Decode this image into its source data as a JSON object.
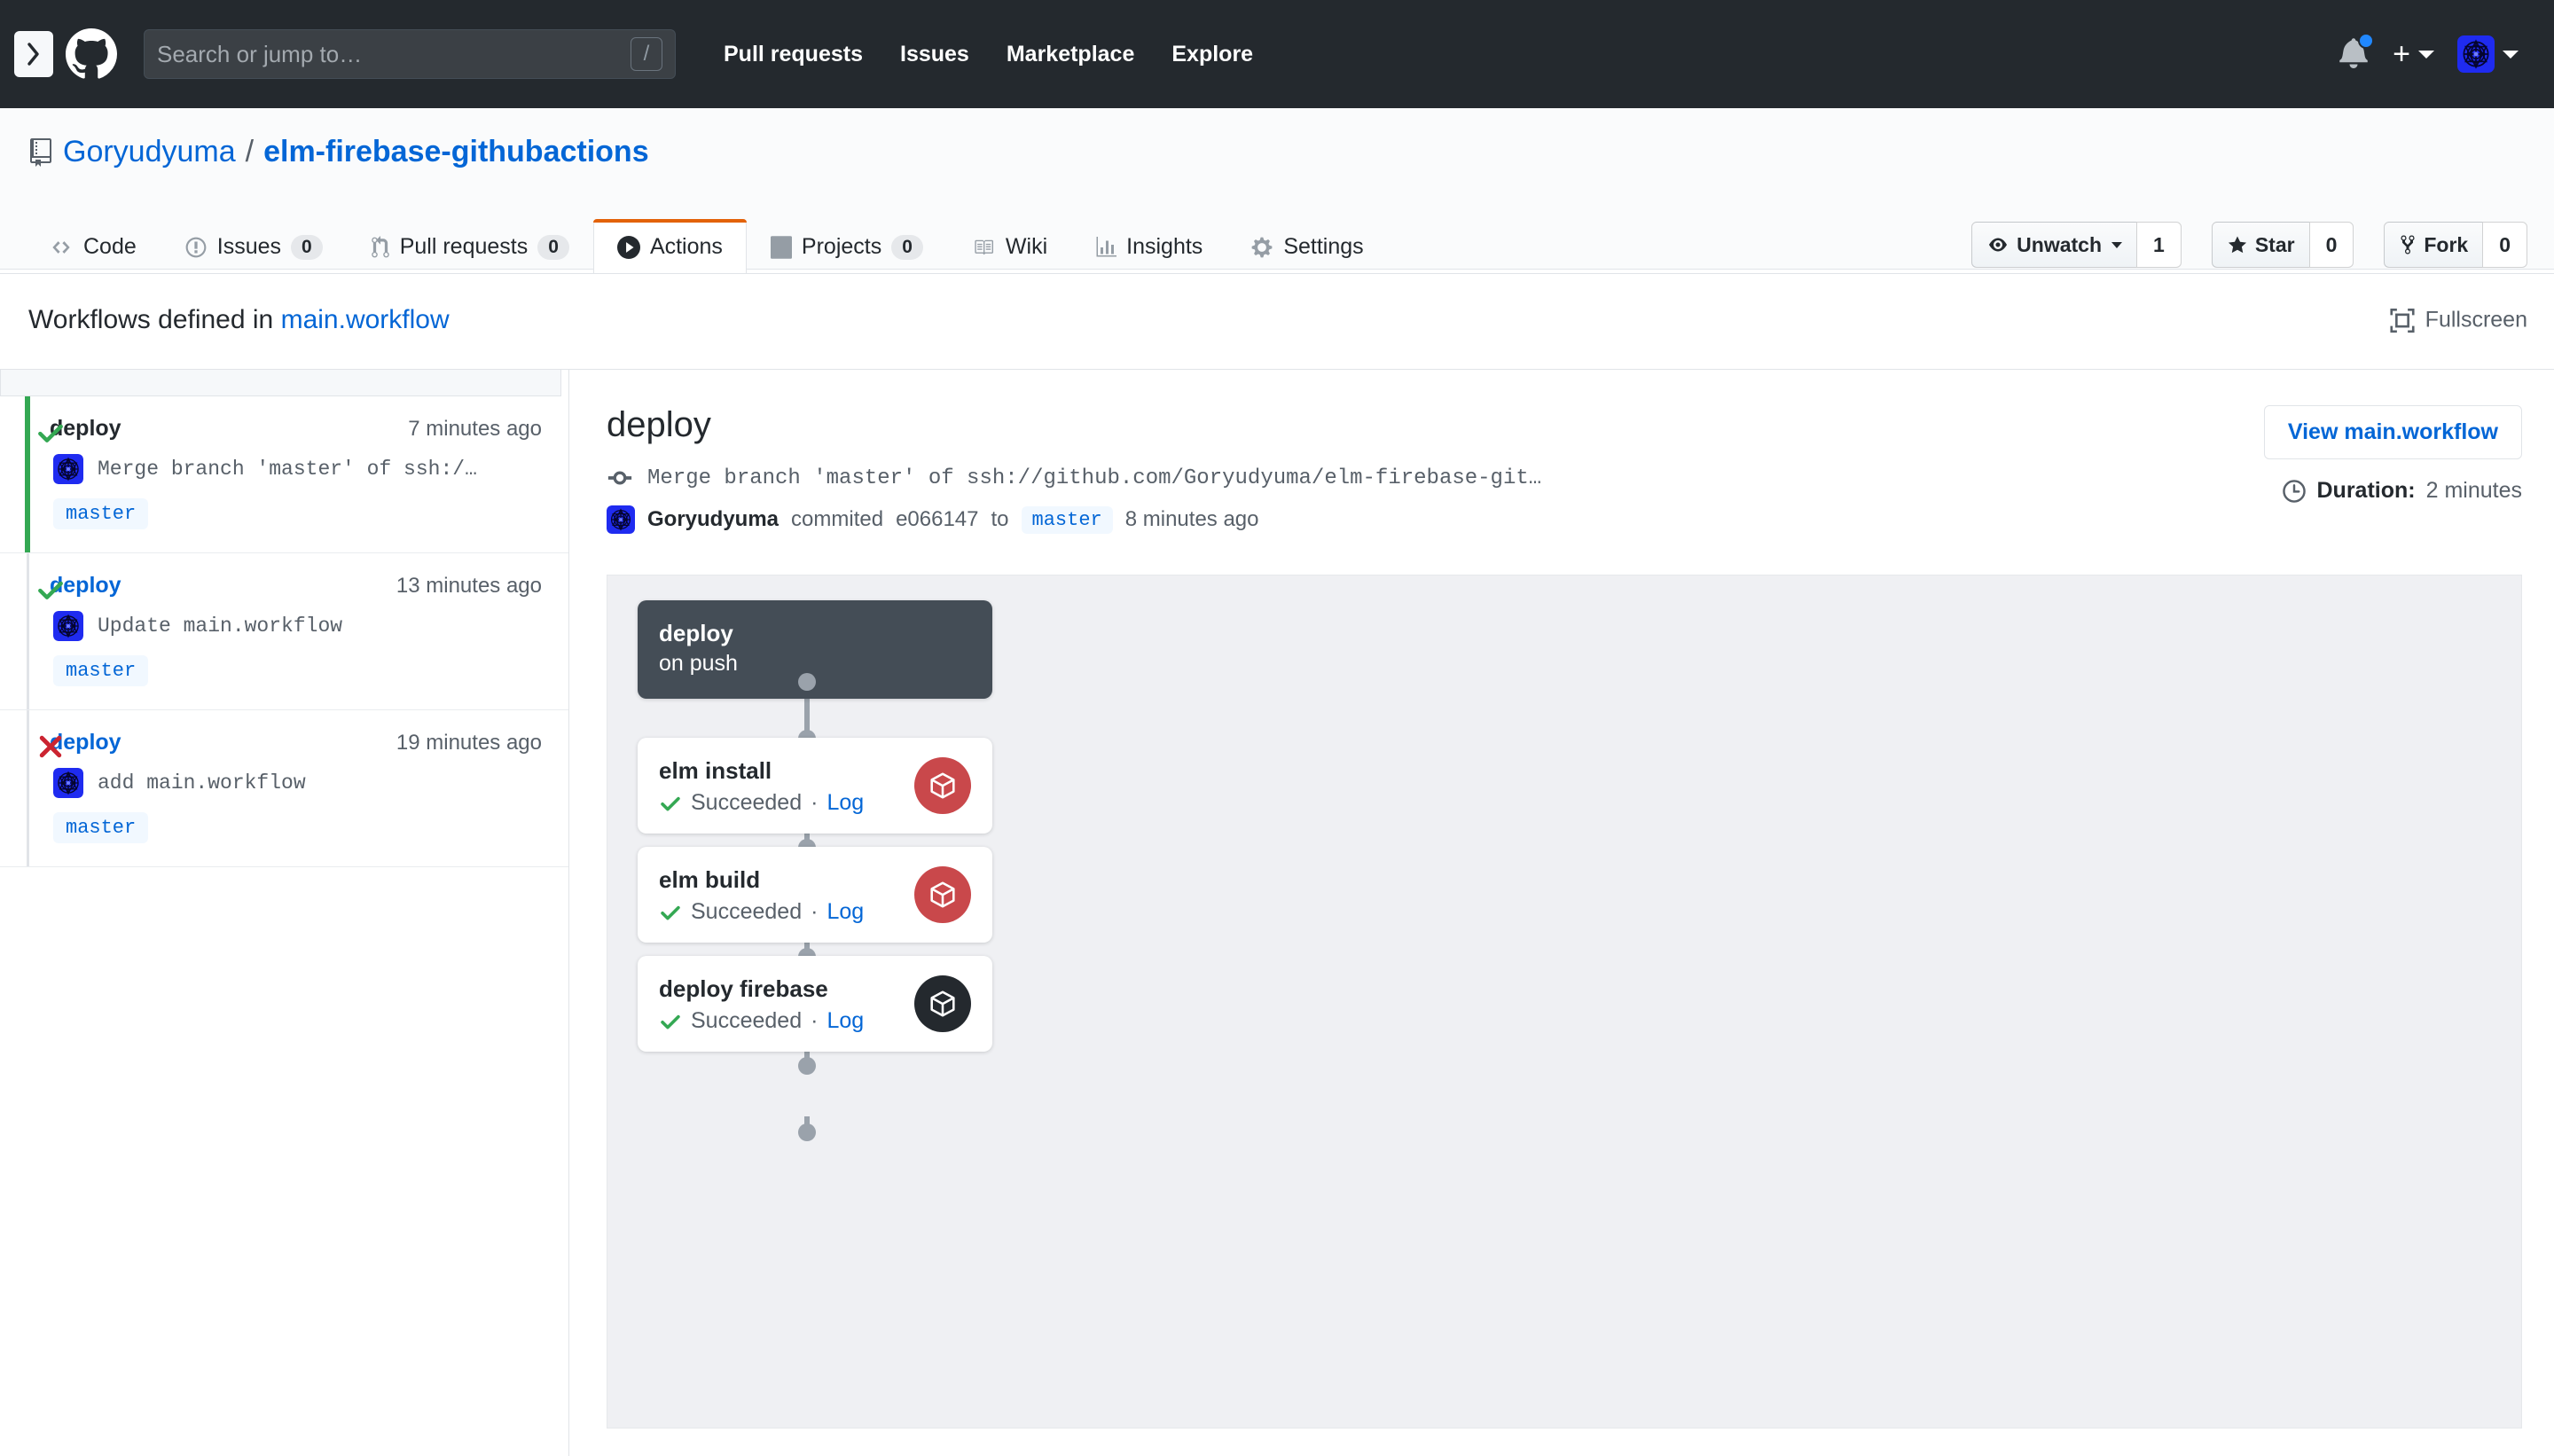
{
  "header": {
    "sidebar_toggle_icon": "chevron-right-icon",
    "logo_icon": "github-logo-icon",
    "search_placeholder": "Search or jump to…",
    "search_value": "",
    "slash_hint": "/",
    "nav": [
      {
        "label": "Pull requests"
      },
      {
        "label": "Issues"
      },
      {
        "label": "Marketplace"
      },
      {
        "label": "Explore"
      }
    ],
    "notifications_icon": "bell-icon",
    "create_new_icon": "plus-icon",
    "profile_icon": "avatar"
  },
  "repo": {
    "book_icon": "repo-book-icon",
    "owner": "Goryudyuma",
    "separator": "/",
    "name": "elm-firebase-githubactions",
    "actions": [
      {
        "icon": "eye-icon",
        "label": "Unwatch",
        "count": "1",
        "has_caret": true
      },
      {
        "icon": "star-icon",
        "label": "Star",
        "count": "0",
        "has_caret": false
      },
      {
        "icon": "fork-icon",
        "label": "Fork",
        "count": "0",
        "has_caret": false
      }
    ]
  },
  "tabs": [
    {
      "icon": "code-icon",
      "label": "Code",
      "count": null,
      "selected": false
    },
    {
      "icon": "issue-opened-icon",
      "label": "Issues",
      "count": "0",
      "selected": false
    },
    {
      "icon": "git-pull-request-icon",
      "label": "Pull requests",
      "count": "0",
      "selected": false
    },
    {
      "icon": "play-icon",
      "label": "Actions",
      "count": null,
      "selected": true
    },
    {
      "icon": "project-icon",
      "label": "Projects",
      "count": "0",
      "selected": false
    },
    {
      "icon": "book-icon",
      "label": "Wiki",
      "count": null,
      "selected": false
    },
    {
      "icon": "graph-icon",
      "label": "Insights",
      "count": null,
      "selected": false
    },
    {
      "icon": "gear-icon",
      "label": "Settings",
      "count": null,
      "selected": false
    }
  ],
  "workflow_bar": {
    "prefix": "Workflows defined in",
    "file": "main.workflow",
    "fullscreen_icon": "fullscreen-icon",
    "fullscreen_label": "Fullscreen"
  },
  "runs": [
    {
      "status": "success",
      "status_icon": "check-icon",
      "title": "deploy",
      "time": "7 minutes ago",
      "commit_message": "Merge branch 'master' of ssh:/…",
      "branch": "master",
      "selected": true
    },
    {
      "status": "success",
      "status_icon": "check-icon",
      "title": "deploy",
      "time": "13 minutes ago",
      "commit_message": "Update main.workflow",
      "branch": "master",
      "selected": false
    },
    {
      "status": "failure",
      "status_icon": "x-icon",
      "title": "deploy",
      "time": "19 minutes ago",
      "commit_message": "add main.workflow",
      "branch": "master",
      "selected": false
    }
  ],
  "detail": {
    "title": "deploy",
    "commit_icon": "git-commit-icon",
    "commit_message": "Merge branch 'master' of ssh://github.com/Goryudyuma/elm-firebase-git…",
    "author": "Goryudyuma",
    "committed_text": "commited",
    "sha": "e066147",
    "to_text": "to",
    "branch": "master",
    "time": "8 minutes ago",
    "view_button": "View main.workflow",
    "clock_icon": "clock-icon",
    "duration_label": "Duration:",
    "duration_value": "2 minutes"
  },
  "graph": {
    "trigger": {
      "name": "deploy",
      "event": "on push"
    },
    "actions": [
      {
        "name": "elm install",
        "status": "Succeeded",
        "status_icon": "check-icon",
        "separator": "·",
        "log_label": "Log",
        "badge_icon": "package-icon",
        "badge_color": "#c9484b"
      },
      {
        "name": "elm build",
        "status": "Succeeded",
        "status_icon": "check-icon",
        "separator": "·",
        "log_label": "Log",
        "badge_icon": "package-icon",
        "badge_color": "#c9484b"
      },
      {
        "name": "deploy firebase",
        "status": "Succeeded",
        "status_icon": "check-icon",
        "separator": "·",
        "log_label": "Log",
        "badge_icon": "package-icon",
        "badge_color": "#24292e"
      }
    ]
  },
  "colors": {
    "header_bg": "#24292e",
    "accent_blue": "#0366d6",
    "success_green": "#28a745",
    "failure_red": "#cb2431",
    "tab_active_orange": "#e36209",
    "canvas_bg": "#eff0f3"
  }
}
